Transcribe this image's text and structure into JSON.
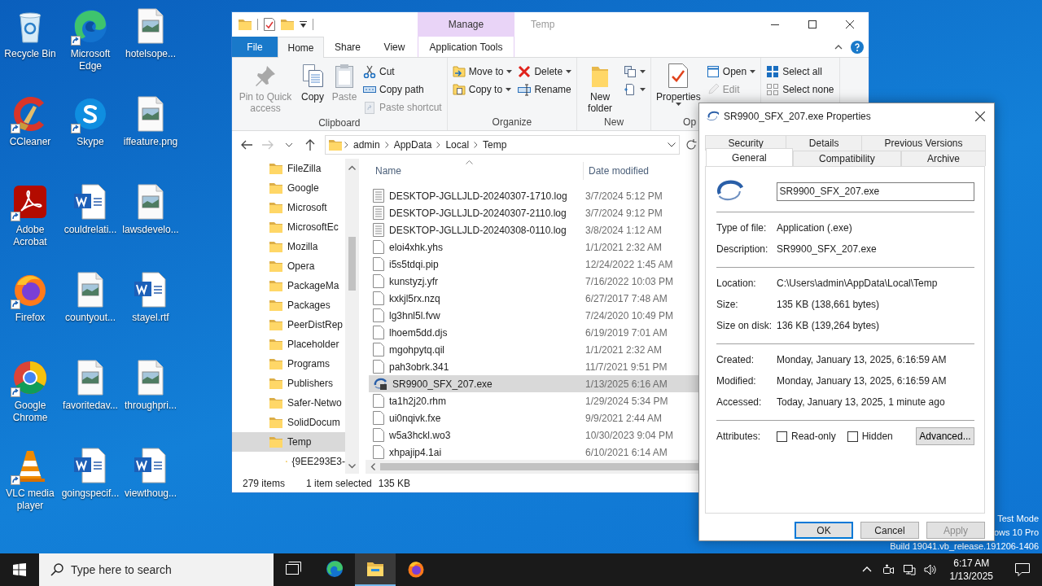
{
  "desktop_icons": [
    {
      "label": "Recycle Bin",
      "kind": "recycle_bin",
      "shortcut": false
    },
    {
      "label": "Microsoft Edge",
      "kind": "edge",
      "shortcut": true
    },
    {
      "label": "hotelsope...",
      "kind": "image",
      "shortcut": false
    },
    {
      "label": "CCleaner",
      "kind": "ccleaner",
      "shortcut": true
    },
    {
      "label": "Skype",
      "kind": "skype",
      "shortcut": true
    },
    {
      "label": "iffeature.png",
      "kind": "image",
      "shortcut": false
    },
    {
      "label": "Adobe Acrobat",
      "kind": "acrobat",
      "shortcut": true
    },
    {
      "label": "couldrelati...",
      "kind": "word",
      "shortcut": false
    },
    {
      "label": "lawsdevelo...",
      "kind": "image",
      "shortcut": false
    },
    {
      "label": "Firefox",
      "kind": "firefox",
      "shortcut": true
    },
    {
      "label": "countyout...",
      "kind": "image",
      "shortcut": false
    },
    {
      "label": "stayel.rtf",
      "kind": "word",
      "shortcut": false
    },
    {
      "label": "Google Chrome",
      "kind": "chrome",
      "shortcut": true
    },
    {
      "label": "favoritedav...",
      "kind": "image",
      "shortcut": false
    },
    {
      "label": "throughpri...",
      "kind": "image",
      "shortcut": false
    },
    {
      "label": "VLC media player",
      "kind": "vlc",
      "shortcut": true
    },
    {
      "label": "goingspecif...",
      "kind": "word",
      "shortcut": false
    },
    {
      "label": "viewthoug...",
      "kind": "word",
      "shortcut": false
    }
  ],
  "explorer": {
    "title": "Temp",
    "context_tab": "Manage",
    "tabs": [
      {
        "label": "File",
        "kind": "file",
        "selected": false
      },
      {
        "label": "Home",
        "kind": "normal",
        "selected": true
      },
      {
        "label": "Share",
        "kind": "normal",
        "selected": false
      },
      {
        "label": "View",
        "kind": "normal",
        "selected": false
      },
      {
        "label": "Application Tools",
        "kind": "context",
        "selected": false
      }
    ],
    "ribbon_groups": [
      {
        "label": "Clipboard",
        "items": [
          {
            "kind": "large",
            "label": "Pin to Quick access",
            "disabled": true,
            "dropdown": false
          },
          {
            "kind": "large",
            "label": "Copy",
            "disabled": false,
            "dropdown": false
          },
          {
            "kind": "large",
            "label": "Paste",
            "disabled": true,
            "dropdown": false
          },
          {
            "kind": "stack",
            "items": [
              {
                "label": "Cut",
                "disabled": false,
                "dropdown": false
              },
              {
                "label": "Copy path",
                "disabled": false,
                "dropdown": false
              },
              {
                "label": "Paste shortcut",
                "disabled": true,
                "dropdown": false
              }
            ]
          }
        ]
      },
      {
        "label": "Organize",
        "items": [
          {
            "kind": "stack",
            "items": [
              {
                "label": "Move to",
                "disabled": false,
                "dropdown": true
              },
              {
                "label": "Copy to",
                "disabled": false,
                "dropdown": true
              }
            ]
          },
          {
            "kind": "stack",
            "items": [
              {
                "label": "Delete",
                "disabled": false,
                "dropdown": true
              },
              {
                "label": "Rename",
                "disabled": false,
                "dropdown": false
              }
            ]
          }
        ]
      },
      {
        "label": "New",
        "items": [
          {
            "kind": "large",
            "label": "New folder",
            "disabled": false,
            "dropdown": false
          },
          {
            "kind": "stack",
            "items": [
              {
                "disabled": false,
                "dropdown": true
              },
              {
                "disabled": false,
                "dropdown": true
              }
            ]
          }
        ]
      },
      {
        "label": "Op",
        "items": [
          {
            "kind": "large",
            "label": "Properties",
            "disabled": false,
            "dropdown": true
          },
          {
            "kind": "stack",
            "items": [
              {
                "label": "Open",
                "disabled": false,
                "dropdown": true
              },
              {
                "label": "Edit",
                "disabled": true,
                "dropdown": false
              }
            ]
          }
        ]
      },
      {
        "items": [
          {
            "kind": "stack",
            "items": [
              {
                "label": "Select all",
                "disabled": false,
                "dropdown": false
              },
              {
                "label": "Select none",
                "disabled": false,
                "dropdown": false
              }
            ]
          }
        ]
      }
    ],
    "crumbs": [
      "admin",
      "AppData",
      "Local",
      "Temp"
    ],
    "tree": [
      {
        "label": "FileZilla",
        "selected": false
      },
      {
        "label": "Google",
        "selected": false
      },
      {
        "label": "Microsoft",
        "selected": false
      },
      {
        "label": "MicrosoftEc",
        "selected": false
      },
      {
        "label": "Mozilla",
        "selected": false
      },
      {
        "label": "Opera",
        "selected": false
      },
      {
        "label": "PackageMa",
        "selected": false
      },
      {
        "label": "Packages",
        "selected": false
      },
      {
        "label": "PeerDistRep",
        "selected": false
      },
      {
        "label": "Placeholder",
        "selected": false
      },
      {
        "label": "Programs",
        "selected": false
      },
      {
        "label": "Publishers",
        "selected": false
      },
      {
        "label": "Safer-Netwo",
        "selected": false
      },
      {
        "label": "SolidDocum",
        "selected": false
      },
      {
        "label": "Temp",
        "selected": true,
        "children": [
          {
            "label": "{9EE293E3-",
            "selected": false
          }
        ]
      }
    ],
    "columns": [
      {
        "label": "Name",
        "sorted": true
      },
      {
        "label": "Date modified",
        "sorted": false
      }
    ],
    "files": [
      {
        "name": "DESKTOP-JGLLJLD-20240307-1710.log",
        "date": "3/7/2024 5:12 PM",
        "kind": "log",
        "selected": false
      },
      {
        "name": "DESKTOP-JGLLJLD-20240307-2110.log",
        "date": "3/7/2024 9:12 PM",
        "kind": "log",
        "selected": false
      },
      {
        "name": "DESKTOP-JGLLJLD-20240308-0110.log",
        "date": "3/8/2024 1:12 AM",
        "kind": "log",
        "selected": false
      },
      {
        "name": "eloi4xhk.yhs",
        "date": "1/1/2021 2:32 AM",
        "kind": "file",
        "selected": false
      },
      {
        "name": "i5s5tdqi.pip",
        "date": "12/24/2022 1:45 AM",
        "kind": "file",
        "selected": false
      },
      {
        "name": "kunstyzj.yfr",
        "date": "7/16/2022 10:03 PM",
        "kind": "file",
        "selected": false
      },
      {
        "name": "kxkjl5rx.nzq",
        "date": "6/27/2017 7:48 AM",
        "kind": "file",
        "selected": false
      },
      {
        "name": "lg3hnl5l.fvw",
        "date": "7/24/2020 10:49 PM",
        "kind": "file",
        "selected": false
      },
      {
        "name": "lhoem5dd.djs",
        "date": "6/19/2019 7:01 AM",
        "kind": "file",
        "selected": false
      },
      {
        "name": "mgohpytq.qil",
        "date": "1/1/2021 2:32 AM",
        "kind": "file",
        "selected": false
      },
      {
        "name": "pah3obrk.341",
        "date": "11/7/2021 9:51 PM",
        "kind": "file",
        "selected": false
      },
      {
        "name": "SR9900_SFX_207.exe",
        "date": "1/13/2025 6:16 AM",
        "kind": "exe",
        "selected": true
      },
      {
        "name": "ta1h2j20.rhm",
        "date": "1/29/2024 5:34 PM",
        "kind": "file",
        "selected": false
      },
      {
        "name": "ui0nqivk.fxe",
        "date": "9/9/2021 2:44 AM",
        "kind": "file",
        "selected": false
      },
      {
        "name": "w5a3hckl.wo3",
        "date": "10/30/2023 9:04 PM",
        "kind": "file",
        "selected": false
      },
      {
        "name": "xhpajip4.1ai",
        "date": "6/10/2021 6:14 AM",
        "kind": "file",
        "selected": false
      }
    ],
    "status": {
      "items": "279 items",
      "selection": "1 item selected",
      "size": "135 KB"
    }
  },
  "dialog": {
    "title": "SR9900_SFX_207.exe Properties",
    "tab_rows": [
      {
        "tabs": [
          {
            "label": "Security",
            "selected": false
          },
          {
            "label": "Details",
            "selected": false
          },
          {
            "label": "Previous Versions",
            "selected": false
          }
        ]
      },
      {
        "tabs": [
          {
            "label": "General",
            "selected": true
          },
          {
            "label": "Compatibility",
            "selected": false
          },
          {
            "label": "Archive",
            "selected": false
          }
        ]
      }
    ],
    "file_name": "SR9900_SFX_207.exe",
    "sections": [
      {
        "rows": [
          {
            "label": "Type of file:",
            "value": "Application (.exe)"
          },
          {
            "label": "Description:",
            "value": "SR9900_SFX_207.exe"
          }
        ]
      },
      {
        "rows": [
          {
            "label": "Location:",
            "value": "C:\\Users\\admin\\AppData\\Local\\Temp"
          },
          {
            "label": "Size:",
            "value": "135 KB (138,661 bytes)"
          },
          {
            "label": "Size on disk:",
            "value": "136 KB (139,264 bytes)"
          }
        ]
      },
      {
        "rows": [
          {
            "label": "Created:",
            "value": "Monday, January 13, 2025, 6:16:59 AM"
          },
          {
            "label": "Modified:",
            "value": "Monday, January 13, 2025, 6:16:59 AM"
          },
          {
            "label": "Accessed:",
            "value": "Today, January 13, 2025, 1 minute ago"
          }
        ]
      }
    ],
    "attributes": {
      "label": "Attributes:",
      "options": [
        {
          "label": "Read-only",
          "checked": false
        },
        {
          "label": "Hidden",
          "checked": false
        }
      ],
      "button": "Advanced..."
    },
    "buttons": [
      {
        "label": "OK",
        "kind": "default",
        "disabled": false
      },
      {
        "label": "Cancel",
        "kind": "normal",
        "disabled": false
      },
      {
        "label": "Apply",
        "kind": "normal",
        "disabled": true
      }
    ]
  },
  "system_watermark": [
    "Test Mode",
    "ows 10 Pro",
    "Build 19041.vb_release.191206-1406"
  ],
  "taskbar": {
    "search_placeholder": "Type here to search",
    "apps": [
      {
        "kind": "task_view",
        "active": false
      },
      {
        "kind": "edge",
        "active": false
      },
      {
        "kind": "explorer",
        "active": true
      },
      {
        "kind": "firefox",
        "active": false
      }
    ],
    "time": "6:17 AM",
    "date": "1/13/2025"
  }
}
